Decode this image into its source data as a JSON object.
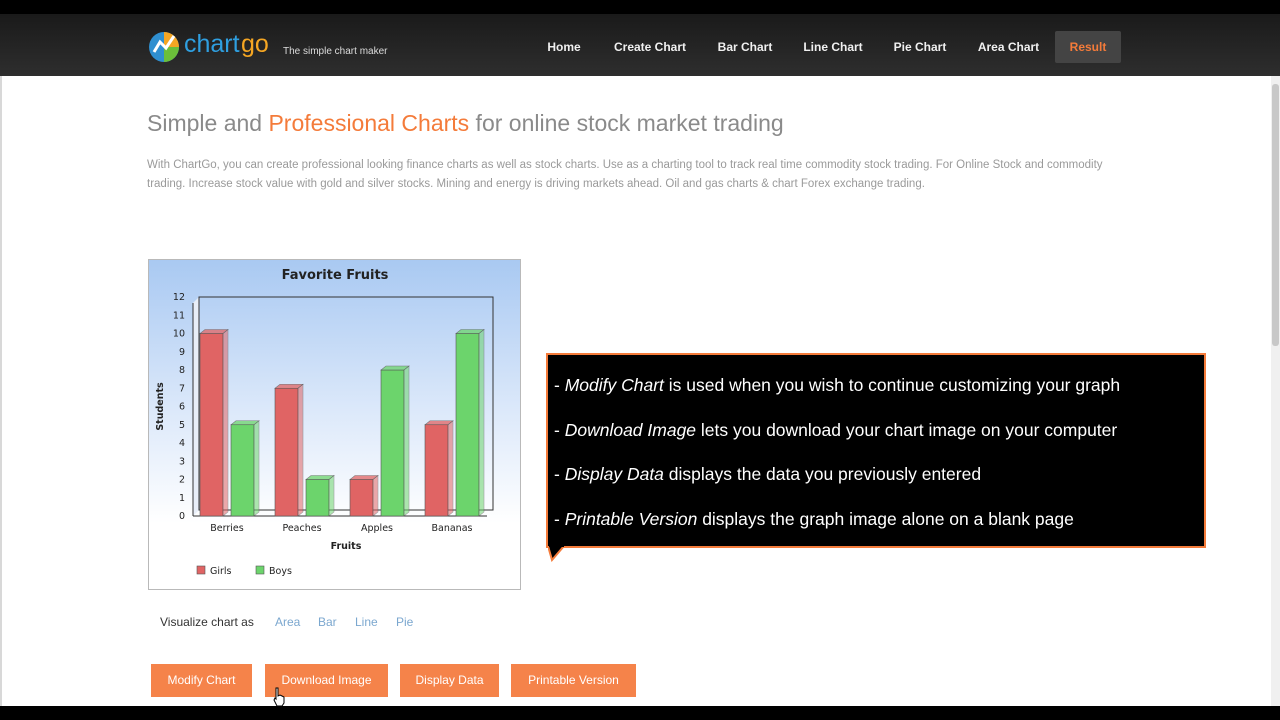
{
  "brand": {
    "name_part1": "chart",
    "name_part2": "go",
    "tagline": "The simple chart maker"
  },
  "nav": {
    "items": [
      "Home",
      "Create Chart",
      "Bar Chart",
      "Line Chart",
      "Pie Chart",
      "Area Chart",
      "Result"
    ],
    "active": "Result"
  },
  "headline": {
    "part1": "Simple and ",
    "accent": "Professional Charts",
    "part2": " for online stock market trading"
  },
  "intro": "With ChartGo, you can create professional looking finance charts as well as stock charts. Use as a charting tool to track real time commodity stock trading. For Online Stock and commodity trading. Increase stock value with gold and silver stocks. Mining and energy is driving markets ahead. Oil and gas charts & chart Forex exchange trading.",
  "chart_data": {
    "type": "bar",
    "title": "Favorite Fruits",
    "xlabel": "Fruits",
    "ylabel": "Students",
    "categories": [
      "Berries",
      "Peaches",
      "Apples",
      "Bananas"
    ],
    "series": [
      {
        "name": "Girls",
        "values": [
          10,
          7,
          2,
          5
        ],
        "color": "#e06464"
      },
      {
        "name": "Boys",
        "values": [
          5,
          2,
          8,
          10
        ],
        "color": "#6cd46c"
      }
    ],
    "ylim": [
      0,
      12
    ],
    "yticks": [
      "0",
      "1",
      "2",
      "3",
      "4",
      "5",
      "6",
      "7",
      "8",
      "9",
      "10",
      "11",
      "12"
    ],
    "legend_position": "bottom-left"
  },
  "callout": {
    "lines": [
      {
        "term": "Modify Chart",
        "rest": " is used when you wish to continue customizing your graph"
      },
      {
        "term": "Download Image",
        "rest": " lets you download your chart image on your computer"
      },
      {
        "term": "Display Data",
        "rest": " displays the data you previously entered"
      },
      {
        "term": "Printable Version",
        "rest": " displays the graph image alone on a blank page"
      }
    ],
    "prefix": "- "
  },
  "visualize": {
    "label": "Visualize chart as",
    "options": [
      "Area",
      "Bar",
      "Line",
      "Pie"
    ]
  },
  "buttons": [
    "Modify Chart",
    "Download Image",
    "Display Data",
    "Printable Version"
  ],
  "colors": {
    "accent": "#f47b3a",
    "button": "#f5834a",
    "link": "#7ba7cf",
    "callout_bg": "#000000"
  }
}
